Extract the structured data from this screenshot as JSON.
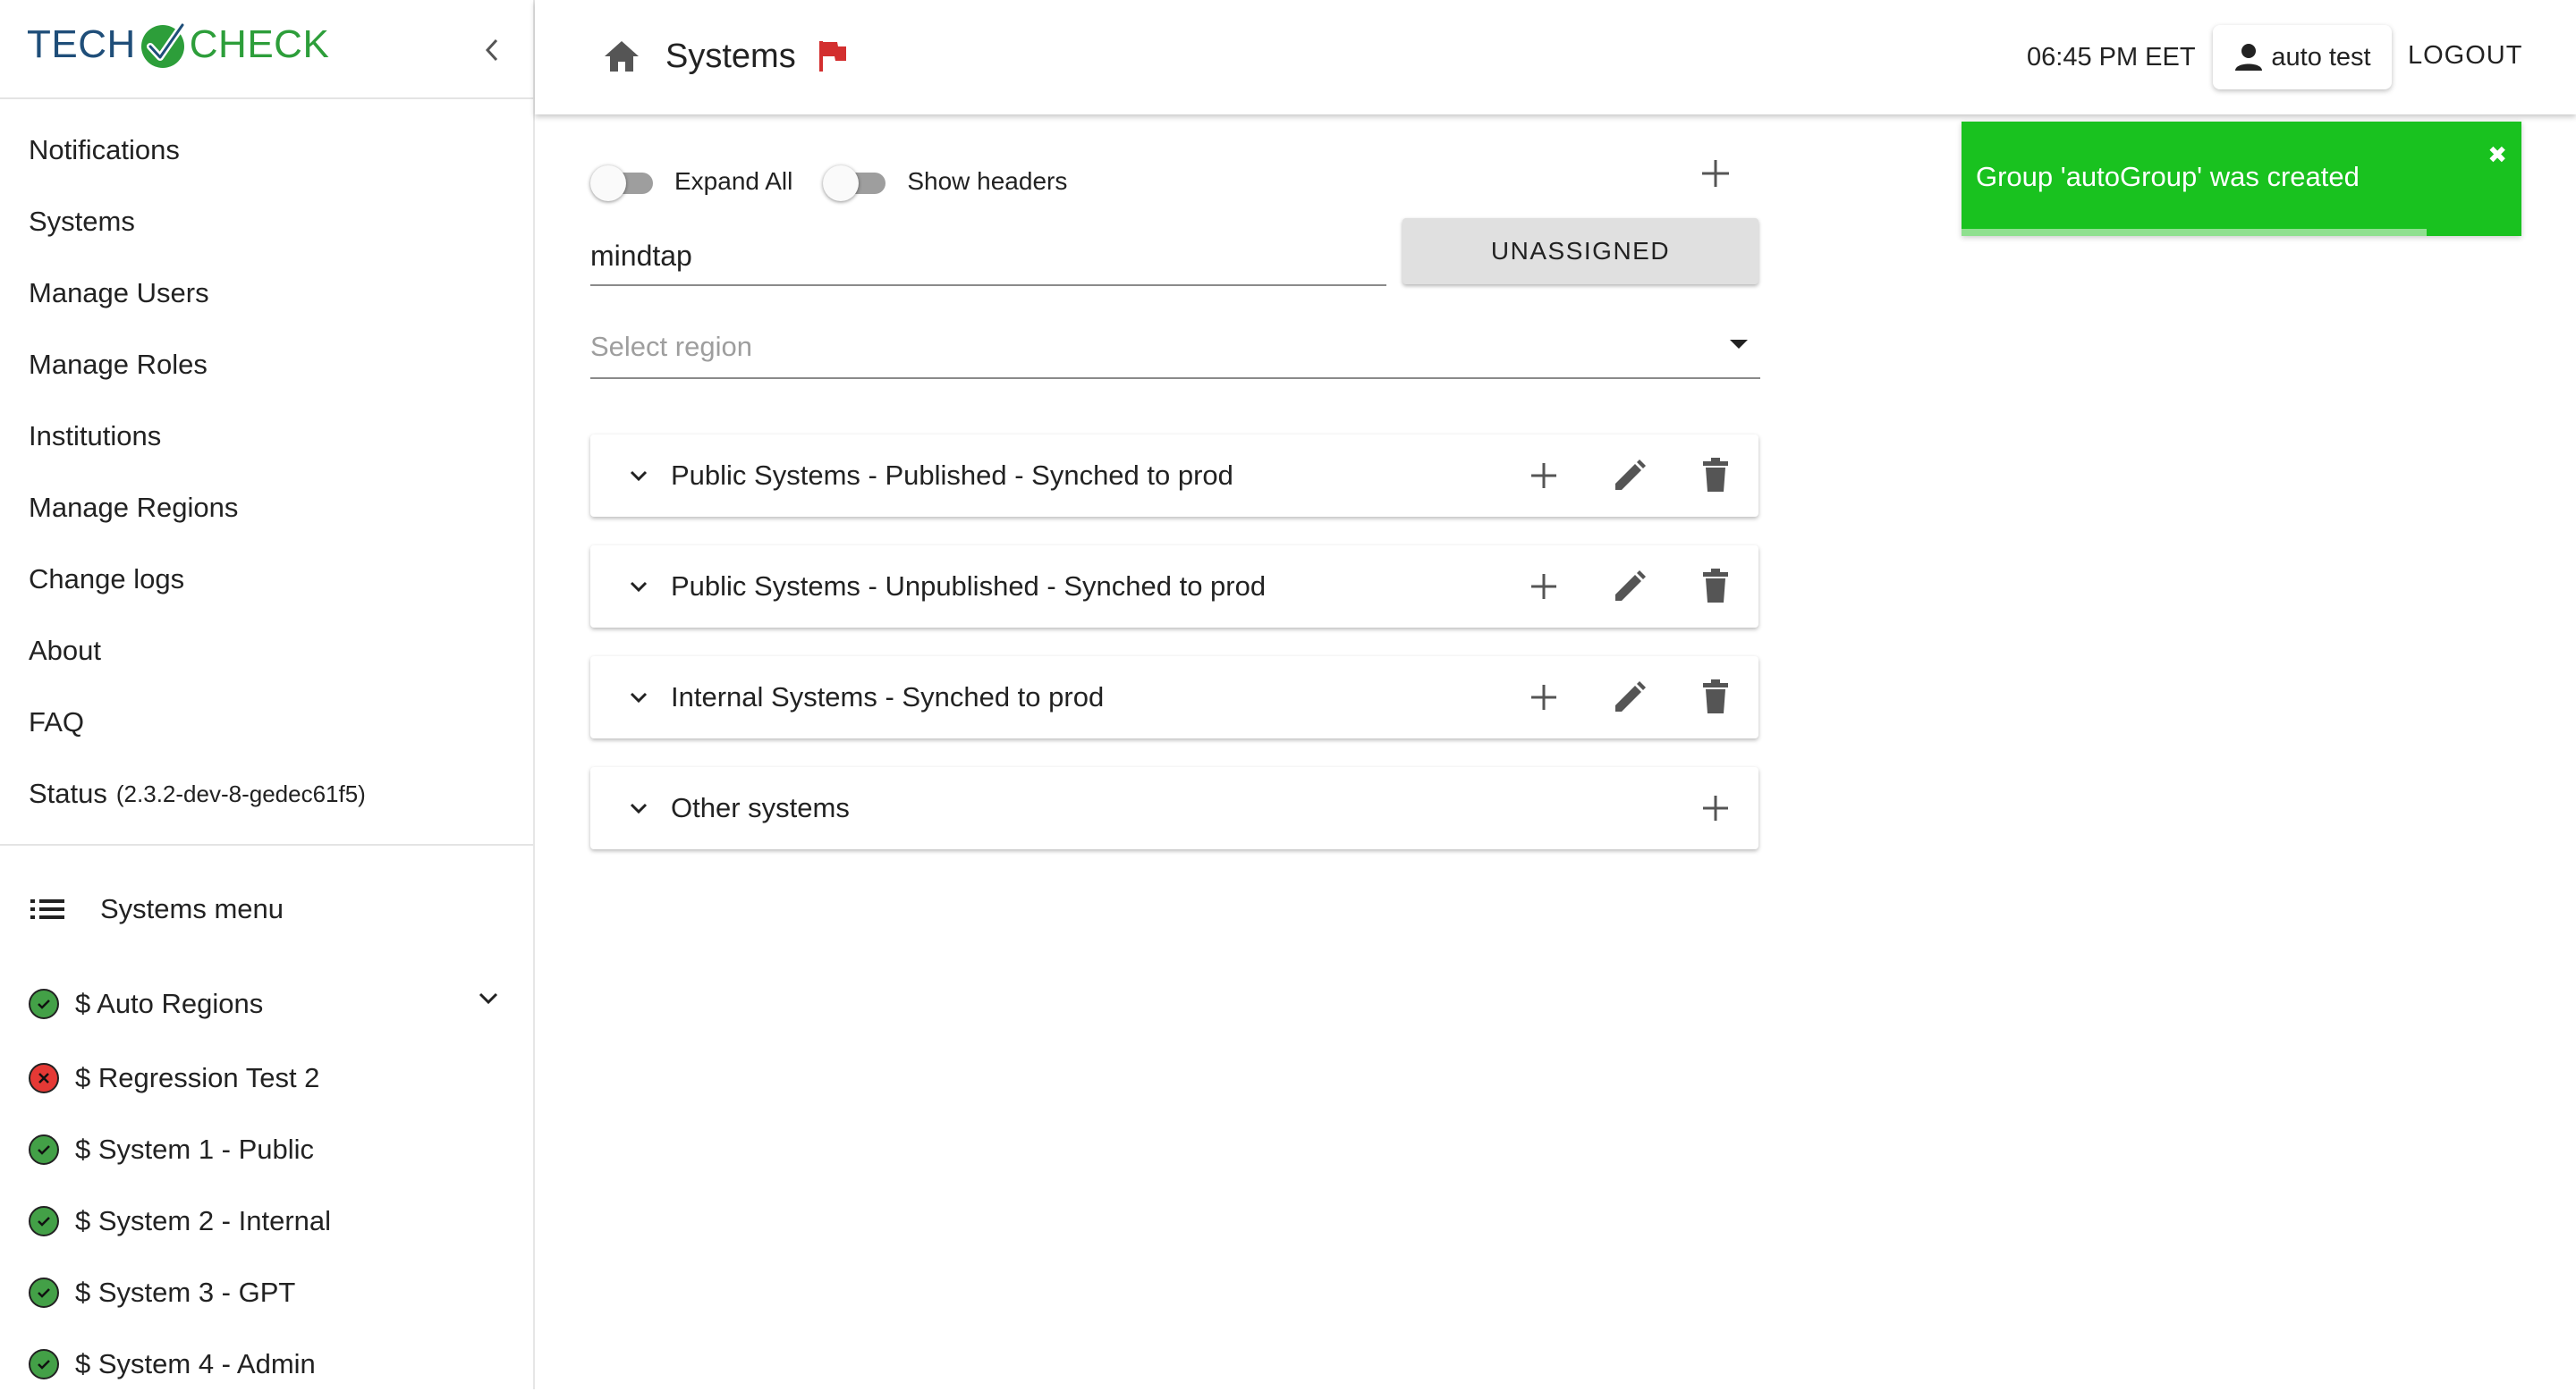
{
  "brand": {
    "part1": "TECH",
    "part2": "CHECK"
  },
  "sidebar": {
    "nav": [
      {
        "label": "Notifications"
      },
      {
        "label": "Systems"
      },
      {
        "label": "Manage Users"
      },
      {
        "label": "Manage Roles"
      },
      {
        "label": "Institutions"
      },
      {
        "label": "Manage Regions"
      },
      {
        "label": "Change logs"
      },
      {
        "label": "About"
      },
      {
        "label": "FAQ"
      }
    ],
    "status": {
      "label": "Status",
      "version": "(2.3.2-dev-8-gedec61f5)"
    },
    "systems_menu": {
      "title": "Systems menu",
      "items": [
        {
          "label": "$ Auto Regions",
          "status": "ok",
          "expandable": true
        },
        {
          "label": "$ Regression Test 2",
          "status": "error"
        },
        {
          "label": "$ System 1 - Public",
          "status": "ok"
        },
        {
          "label": "$ System 2 - Internal",
          "status": "ok"
        },
        {
          "label": "$ System 3 - GPT",
          "status": "ok"
        },
        {
          "label": "$ System 4 - Admin",
          "status": "ok"
        }
      ]
    }
  },
  "header": {
    "title": "Systems",
    "time": "06:45 PM EET",
    "user": "auto test",
    "logout": "LOGOUT"
  },
  "main": {
    "toggles": {
      "expand_all": {
        "label": "Expand All",
        "on": false
      },
      "show_headers": {
        "label": "Show headers",
        "on": false
      }
    },
    "search": {
      "value": "mindtap"
    },
    "unassigned_button": "UNASSIGNED",
    "region_select": {
      "placeholder": "Select region"
    },
    "groups": [
      {
        "title": "Public Systems - Published - Synched to prod",
        "editable": true
      },
      {
        "title": "Public Systems - Unpublished - Synched to prod",
        "editable": true
      },
      {
        "title": "Internal Systems - Synched to prod",
        "editable": true
      },
      {
        "title": "Other systems",
        "editable": false
      }
    ]
  },
  "toast": {
    "message": "Group 'autoGroup' was created",
    "close": "✖",
    "progress": 0.83
  },
  "colors": {
    "ok": "#43a047",
    "error": "#e53935",
    "toast": "#19c21f",
    "flag": "#d32f2f",
    "brand_blue": "#1f4e79",
    "brand_green": "#2d9e3a"
  }
}
